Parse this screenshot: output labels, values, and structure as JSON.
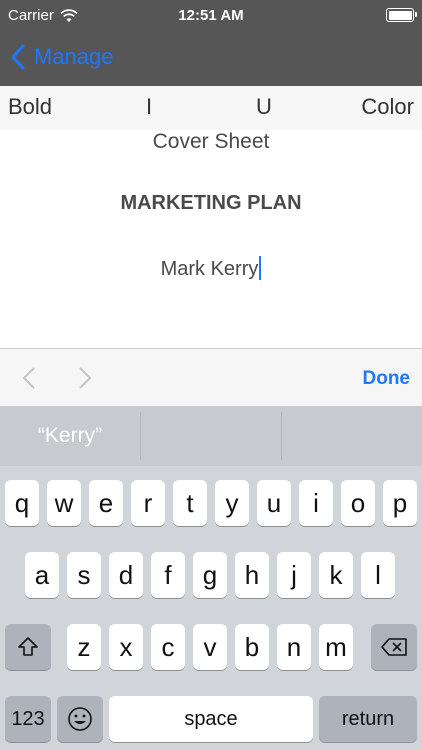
{
  "status": {
    "carrier": "Carrier",
    "time": "12:51 AM"
  },
  "nav": {
    "back_label": "Manage"
  },
  "format_toolbar": {
    "bold": "Bold",
    "italic": "I",
    "underline": "U",
    "color": "Color"
  },
  "document": {
    "cover_sheet": "Cover Sheet",
    "title": "MARKETING PLAN",
    "author": "Mark Kerry"
  },
  "accessory": {
    "done_label": "Done"
  },
  "keyboard": {
    "predictions": [
      "“Kerry”",
      "",
      ""
    ],
    "row1": [
      "q",
      "w",
      "e",
      "r",
      "t",
      "y",
      "u",
      "i",
      "o",
      "p"
    ],
    "row2": [
      "a",
      "s",
      "d",
      "f",
      "g",
      "h",
      "j",
      "k",
      "l"
    ],
    "row3": [
      "z",
      "x",
      "c",
      "v",
      "b",
      "n",
      "m"
    ],
    "numbers_label": "123",
    "space_label": "space",
    "return_label": "return"
  },
  "colors": {
    "nav_bg": "#565656",
    "accent": "#1e78ff",
    "keyboard_bg": "#d1d4d9"
  },
  "icons": {
    "back": "chevron-left-icon",
    "wifi": "wifi-icon",
    "battery": "battery-icon",
    "shift": "shift-icon",
    "delete": "delete-backspace-icon",
    "emoji": "emoji-icon"
  }
}
